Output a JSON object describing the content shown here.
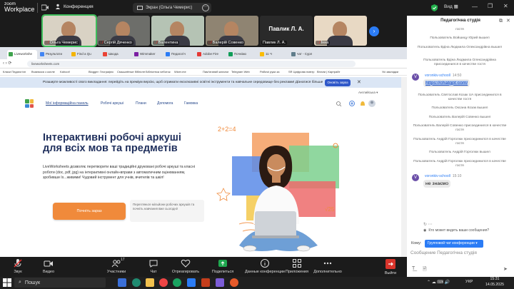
{
  "app": {
    "logo_line1": "zoom",
    "logo_line2": "Workplace",
    "meeting_label": "Конференция",
    "share_label": "Экран (Ольга Чемерис)",
    "view_label": "Вид"
  },
  "participants": [
    {
      "name": "Ольга Чемерис",
      "bg": "#d9d2c4",
      "highlight": true,
      "muted": true
    },
    {
      "name": "Сергій Дяченко",
      "bg": "#6d6e6a",
      "muted": true
    },
    {
      "name": "Валентина",
      "bg": "#b5c3b4",
      "muted": true
    },
    {
      "name": "Валерій Совенко",
      "bg": "#8f8472",
      "muted": true
    },
    {
      "name": "Павлик Л. А.",
      "bg": "#2a2a2a",
      "muted": false,
      "text_tile": true,
      "display": "Павлик Л. А."
    },
    {
      "name": "Інна",
      "bg": "#e8d9c4",
      "muted": true
    }
  ],
  "browser": {
    "tabs": [
      "Liveworkshe",
      "Результати",
      "Find a Qu",
      "Шкода",
      "Wimmaker",
      "Педагогіч",
      "Adobe Fire",
      "Почнімо",
      "11 Ч",
      "чат - Сурл"
    ],
    "url": "liveworksheets.com",
    "bookmarks": [
      "Класи Педагогічн",
      "Вчаємося з колле",
      "Kahoot!",
      "Blogger: Географія",
      "Смышлёные бібліоте",
      "Бібліотека чеботок",
      "Wizer.me",
      "Пам'ятаний каталог",
      "Telegram Web",
      "Рабочіі руки за",
      "SR Цифрова повітр",
      "Вітали | Картрайт",
      "Усі закладки"
    ]
  },
  "banner": {
    "text": "Розширте можливості свого викладання: перейдіть на преміум версію, щоб отримати ексклюзивні освітні інструменти та навчальне середовище без реклами! Дізнатися більше",
    "button": "Оновіть зараз",
    "close": "✕"
  },
  "site": {
    "language": "Английська ▾",
    "nav": [
      "Мої інформаційна панель",
      "Робочі аркуші",
      "Плани",
      "Допомога",
      "Гамовка"
    ],
    "logo_colors": [
      "#3fa34d",
      "#f0b93a",
      "#3a8ad6",
      "#e0544a"
    ],
    "hero": "Інтерактивні робочі аркуші для всіх мов та предметів",
    "description": "LiveWorksheets дозволяє перетворити ваші традиційні друковані робочі аркуші та класні роботи (doc, pdf, jpg) на інтерактивні онлайн-вправи з автоматичним оцінюванням, зробивши їх...живими! Чудовий інструмент для учнів, вчителів та шкіл!",
    "cta": "Почніть зараз",
    "cta_note": "Перегляньте мільйони робочих аркушів та почніть навчання вже сьогодні!",
    "formula": "2+2=4",
    "sqrt": "√25"
  },
  "chat": {
    "title": "Педагогічна студія",
    "messages": [
      {
        "type": "sys",
        "text": "гостя"
      },
      {
        "type": "sys",
        "text": "Пользователь Войшицу Юрий вышел"
      },
      {
        "type": "sys",
        "text": "Пользователь Вдіна Людмила Олександрівна вышел"
      },
      {
        "type": "sys",
        "text": "Пользователь Вдіна Людмила Олександрівна присоединился в качестве гостя"
      },
      {
        "type": "msg",
        "sender": "voronkiv-schooll",
        "time": "14:50",
        "text": "https://chatgpt.com/",
        "link": true
      },
      {
        "type": "sys",
        "text": "Пользователь Святослав Козак UA присоединился в качестве гостя"
      },
      {
        "type": "sys",
        "text": "Пользователь Оксана Козак вышел"
      },
      {
        "type": "sys",
        "text": "Пользователь Валерій Совенко вышел"
      },
      {
        "type": "sys",
        "text": "Пользователь Валерій Совенко присоединился в качестве гостя"
      },
      {
        "type": "sys",
        "text": "Пользователь Андрій Горголюк присоединился в качестве гостя"
      },
      {
        "type": "sys",
        "text": "Пользователь Андрій Горголюк вышел"
      },
      {
        "type": "sys",
        "text": "Пользователь Андрій Горголюк присоединился в качестве гостя"
      },
      {
        "type": "msg",
        "sender": "voronkiv-schooll",
        "time": "15:10",
        "text": "не знаємо",
        "link": false
      }
    ],
    "avatar_letter": "V",
    "who_sees": "Кто может видеть ваши сообщения?",
    "to_label": "Кому:",
    "to_value": "Групповой чат конференции ▾",
    "input_placeholder": "Сообщение Педагогічна студія"
  },
  "toolbar": {
    "items": [
      {
        "label": "Звук",
        "icon": "mic-muted-icon"
      },
      {
        "label": "Видео",
        "icon": "video-icon"
      },
      {
        "label": "Участники",
        "icon": "participants-icon",
        "badge": "17"
      },
      {
        "label": "Чат",
        "icon": "chat-icon"
      },
      {
        "label": "Отреагировать",
        "icon": "react-icon"
      },
      {
        "label": "Поделиться",
        "icon": "share-icon"
      },
      {
        "label": "Данные конференции",
        "icon": "info-icon"
      },
      {
        "label": "Приложения",
        "icon": "apps-icon"
      },
      {
        "label": "Дополнительно",
        "icon": "more-icon"
      }
    ],
    "leave": "Выйти"
  },
  "taskbar": {
    "search": "Пошук",
    "lang": "УКР",
    "time": "15:31",
    "date": "14.05.2025"
  }
}
